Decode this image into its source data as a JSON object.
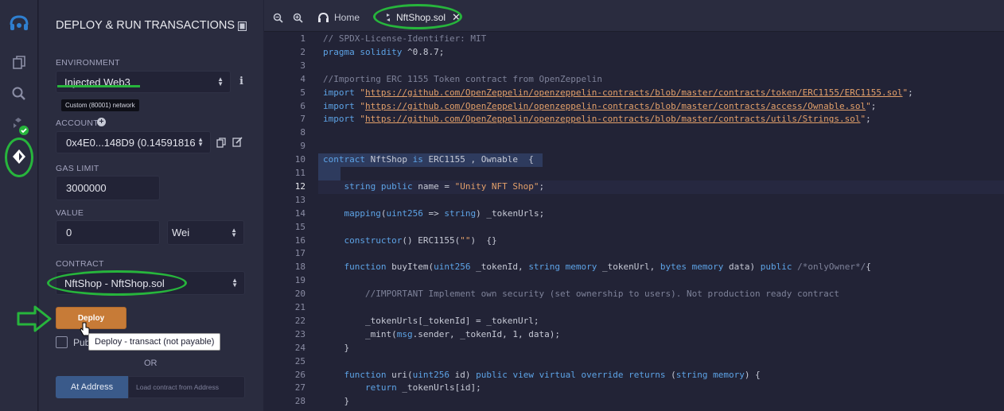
{
  "panel": {
    "title": "DEPLOY & RUN TRANSACTIONS",
    "environment_label": "ENVIRONMENT",
    "environment_value": "Injected Web3",
    "network_badge": "Custom (80001) network",
    "account_label": "ACCOUNT",
    "account_value": "0x4E0...148D9 (0.14591816",
    "gas_limit_label": "GAS LIMIT",
    "gas_limit_value": "3000000",
    "value_label": "VALUE",
    "value_amount": "0",
    "value_unit": "Wei",
    "contract_label": "CONTRACT",
    "contract_value": "NftShop - NftShop.sol",
    "deploy_label": "Deploy",
    "deploy_tooltip": "Deploy - transact (not payable)",
    "publish_label": "Pub",
    "or_label": "OR",
    "at_address_label": "At Address",
    "load_address_label": "Load contract from Address"
  },
  "tabs": [
    {
      "label": "Home"
    },
    {
      "label": "NftShop.sol"
    }
  ],
  "editor": {
    "active_line": 12,
    "lines": [
      {
        "n": "1",
        "html": "<span class='c'>// SPDX-License-Identifier: MIT</span>"
      },
      {
        "n": "2",
        "html": "<span class='k'>pragma solidity</span> ^0.8.7;"
      },
      {
        "n": "3",
        "html": ""
      },
      {
        "n": "4",
        "html": "<span class='c'>//Importing ERC 1155 Token contract from OpenZeppelin</span>"
      },
      {
        "n": "5",
        "html": "<span class='k'>import</span> <span class='s'>\"<span class='u'>https://github.com/OpenZeppelin/openzeppelin-contracts/blob/master/contracts/token/ERC1155/ERC1155.sol</span>\"</span>;"
      },
      {
        "n": "6",
        "html": "<span class='k'>import</span> <span class='s'>\"<span class='u'>https://github.com/OpenZeppelin/openzeppelin-contracts/blob/master/contracts/access/Ownable.sol</span>\"</span>;"
      },
      {
        "n": "7",
        "html": "<span class='k'>import</span> <span class='s'>\"<span class='u'>https://github.com/OpenZeppelin/openzeppelin-contracts/blob/master/contracts/utils/Strings.sol</span>\"</span>;"
      },
      {
        "n": "8",
        "html": ""
      },
      {
        "n": "9",
        "html": ""
      },
      {
        "n": "10",
        "html": "<span class='k'>contract</span> NftShop <span class='k'>is</span> ERC1155 , Ownable  {"
      },
      {
        "n": "11",
        "html": ""
      },
      {
        "n": "12",
        "html": "    <span class='k'>string public</span> name = <span class='s'>\"Unity NFT Shop\"</span>;"
      },
      {
        "n": "13",
        "html": ""
      },
      {
        "n": "14",
        "html": "    <span class='k'>mapping</span>(<span class='k'>uint256</span> => <span class='k'>string</span>) _tokenUrls;"
      },
      {
        "n": "15",
        "html": ""
      },
      {
        "n": "16",
        "html": "    <span class='k'>constructor</span>() ERC1155(<span class='s'>\"\"</span>)  {}"
      },
      {
        "n": "17",
        "html": ""
      },
      {
        "n": "18",
        "html": "    <span class='k'>function</span> buyItem(<span class='k'>uint256</span> _tokenId, <span class='k'>string memory</span> _tokenUrl, <span class='k'>bytes memory</span> data) <span class='k'>public</span> <span class='c'>/*onlyOwner*/</span>{"
      },
      {
        "n": "19",
        "html": ""
      },
      {
        "n": "20",
        "html": "        <span class='c'>//IMPORTANT Implement own security (set ownership to users). Not production ready contract</span>"
      },
      {
        "n": "21",
        "html": ""
      },
      {
        "n": "22",
        "html": "        _tokenUrls[_tokenId] = _tokenUrl;"
      },
      {
        "n": "23",
        "html": "        _mint(<span class='k'>msg</span>.sender, _tokenId, 1, data);"
      },
      {
        "n": "24",
        "html": "    }"
      },
      {
        "n": "25",
        "html": ""
      },
      {
        "n": "26",
        "html": "    <span class='k'>function</span> uri(<span class='k'>uint256</span> id) <span class='k'>public view virtual override returns</span> (<span class='k'>string memory</span>) {"
      },
      {
        "n": "27",
        "html": "        <span class='k'>return</span> _tokenUrls[id];"
      },
      {
        "n": "28",
        "html": "    }"
      }
    ]
  },
  "colors": {
    "accent_orange": "#c77b37",
    "highlight_green": "#27b53c",
    "keyword_blue": "#5da3e6",
    "string_orange": "#e3a06a"
  }
}
